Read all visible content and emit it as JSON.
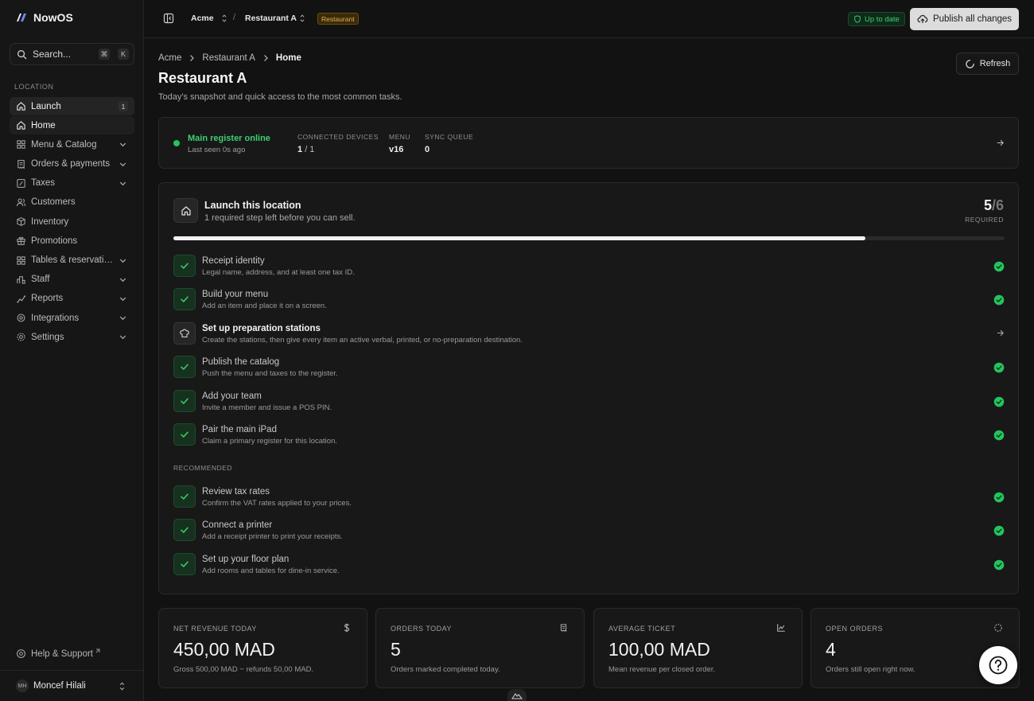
{
  "sidebar": {
    "brand": "NowOS",
    "search": {
      "label": "Search...",
      "shortcut": [
        "⌘",
        "K"
      ]
    },
    "section_label": "LOCATION",
    "items": [
      {
        "label": "Launch",
        "badge": "1",
        "icon": "home-icon"
      },
      {
        "label": "Home",
        "icon": "home-icon"
      },
      {
        "label": "Menu & Catalog",
        "icon": "grid-icon",
        "expandable": true
      },
      {
        "label": "Orders & payments",
        "icon": "receipt-icon",
        "expandable": true
      },
      {
        "label": "Taxes",
        "icon": "percent-icon",
        "expandable": true
      },
      {
        "label": "Customers",
        "icon": "users-icon"
      },
      {
        "label": "Inventory",
        "icon": "box-icon"
      },
      {
        "label": "Promotions",
        "icon": "gift-icon"
      },
      {
        "label": "Tables & reservations",
        "icon": "table-icon",
        "expandable": true
      },
      {
        "label": "Staff",
        "icon": "staff-icon",
        "expandable": true
      },
      {
        "label": "Reports",
        "icon": "chart-icon",
        "expandable": true
      },
      {
        "label": "Integrations",
        "icon": "plug-icon",
        "expandable": true
      },
      {
        "label": "Settings",
        "icon": "gear-icon",
        "expandable": true
      }
    ],
    "help": "Help & Support",
    "user": {
      "initials": "MH",
      "name": "Moncef Hilali"
    }
  },
  "topbar": {
    "org": "Acme",
    "separator": "/",
    "location": "Restaurant A",
    "location_tag": "Restaurant",
    "status": "Up to date",
    "publish_label": "Publish all changes"
  },
  "breadcrumb": [
    "Acme",
    "Restaurant A",
    "Home"
  ],
  "page": {
    "title": "Restaurant A",
    "subtitle": "Today's snapshot and quick access to the most common tasks.",
    "refresh_label": "Refresh"
  },
  "register_status": {
    "title": "Main register online",
    "subtitle": "Last seen 0s ago",
    "connected_devices_label": "CONNECTED DEVICES",
    "connected_devices_value": "1",
    "connected_devices_total": "/ 1",
    "menu_label": "MENU",
    "menu_value": "v16",
    "sync_queue_label": "SYNC QUEUE",
    "sync_queue_value": "0"
  },
  "launch": {
    "title": "Launch this location",
    "subtitle": "1 required step left before you can sell.",
    "done": "5",
    "total": "/6",
    "required_label": "REQUIRED",
    "progress_fraction": 0.833,
    "recommended_label": "RECOMMENDED",
    "required_steps": [
      {
        "title": "Receipt identity",
        "desc": "Legal name, address, and at least one tax ID.",
        "done": true
      },
      {
        "title": "Build your menu",
        "desc": "Add an item and place it on a screen.",
        "done": true
      },
      {
        "title": "Set up preparation stations",
        "desc": "Create the stations, then give every item an active verbal, printed, or no-preparation destination.",
        "done": false
      },
      {
        "title": "Publish the catalog",
        "desc": "Push the menu and taxes to the register.",
        "done": true
      },
      {
        "title": "Add your team",
        "desc": "Invite a member and issue a POS PIN.",
        "done": true
      },
      {
        "title": "Pair the main iPad",
        "desc": "Claim a primary register for this location.",
        "done": true
      }
    ],
    "recommended_steps": [
      {
        "title": "Review tax rates",
        "desc": "Confirm the VAT rates applied to your prices.",
        "done": true
      },
      {
        "title": "Connect a printer",
        "desc": "Add a receipt printer to print your receipts.",
        "done": true
      },
      {
        "title": "Set up your floor plan",
        "desc": "Add rooms and tables for dine-in service.",
        "done": true
      }
    ]
  },
  "metrics": [
    {
      "label": "NET REVENUE TODAY",
      "value": "450,00 MAD",
      "sub": "Gross 500,00 MAD − refunds 50,00 MAD.",
      "icon": "dollar-icon"
    },
    {
      "label": "ORDERS TODAY",
      "value": "5",
      "sub": "Orders marked completed today.",
      "icon": "receipt-icon"
    },
    {
      "label": "AVERAGE TICKET",
      "value": "100,00 MAD",
      "sub": "Mean revenue per closed order.",
      "icon": "chart-icon"
    },
    {
      "label": "OPEN ORDERS",
      "value": "4",
      "sub": "Orders still open right now.",
      "icon": "loader-icon"
    }
  ],
  "colors": {
    "success": "#22c55e",
    "accent_text": "#3ecf71",
    "tag_warning": "#e0b14d",
    "background": "#121212"
  }
}
